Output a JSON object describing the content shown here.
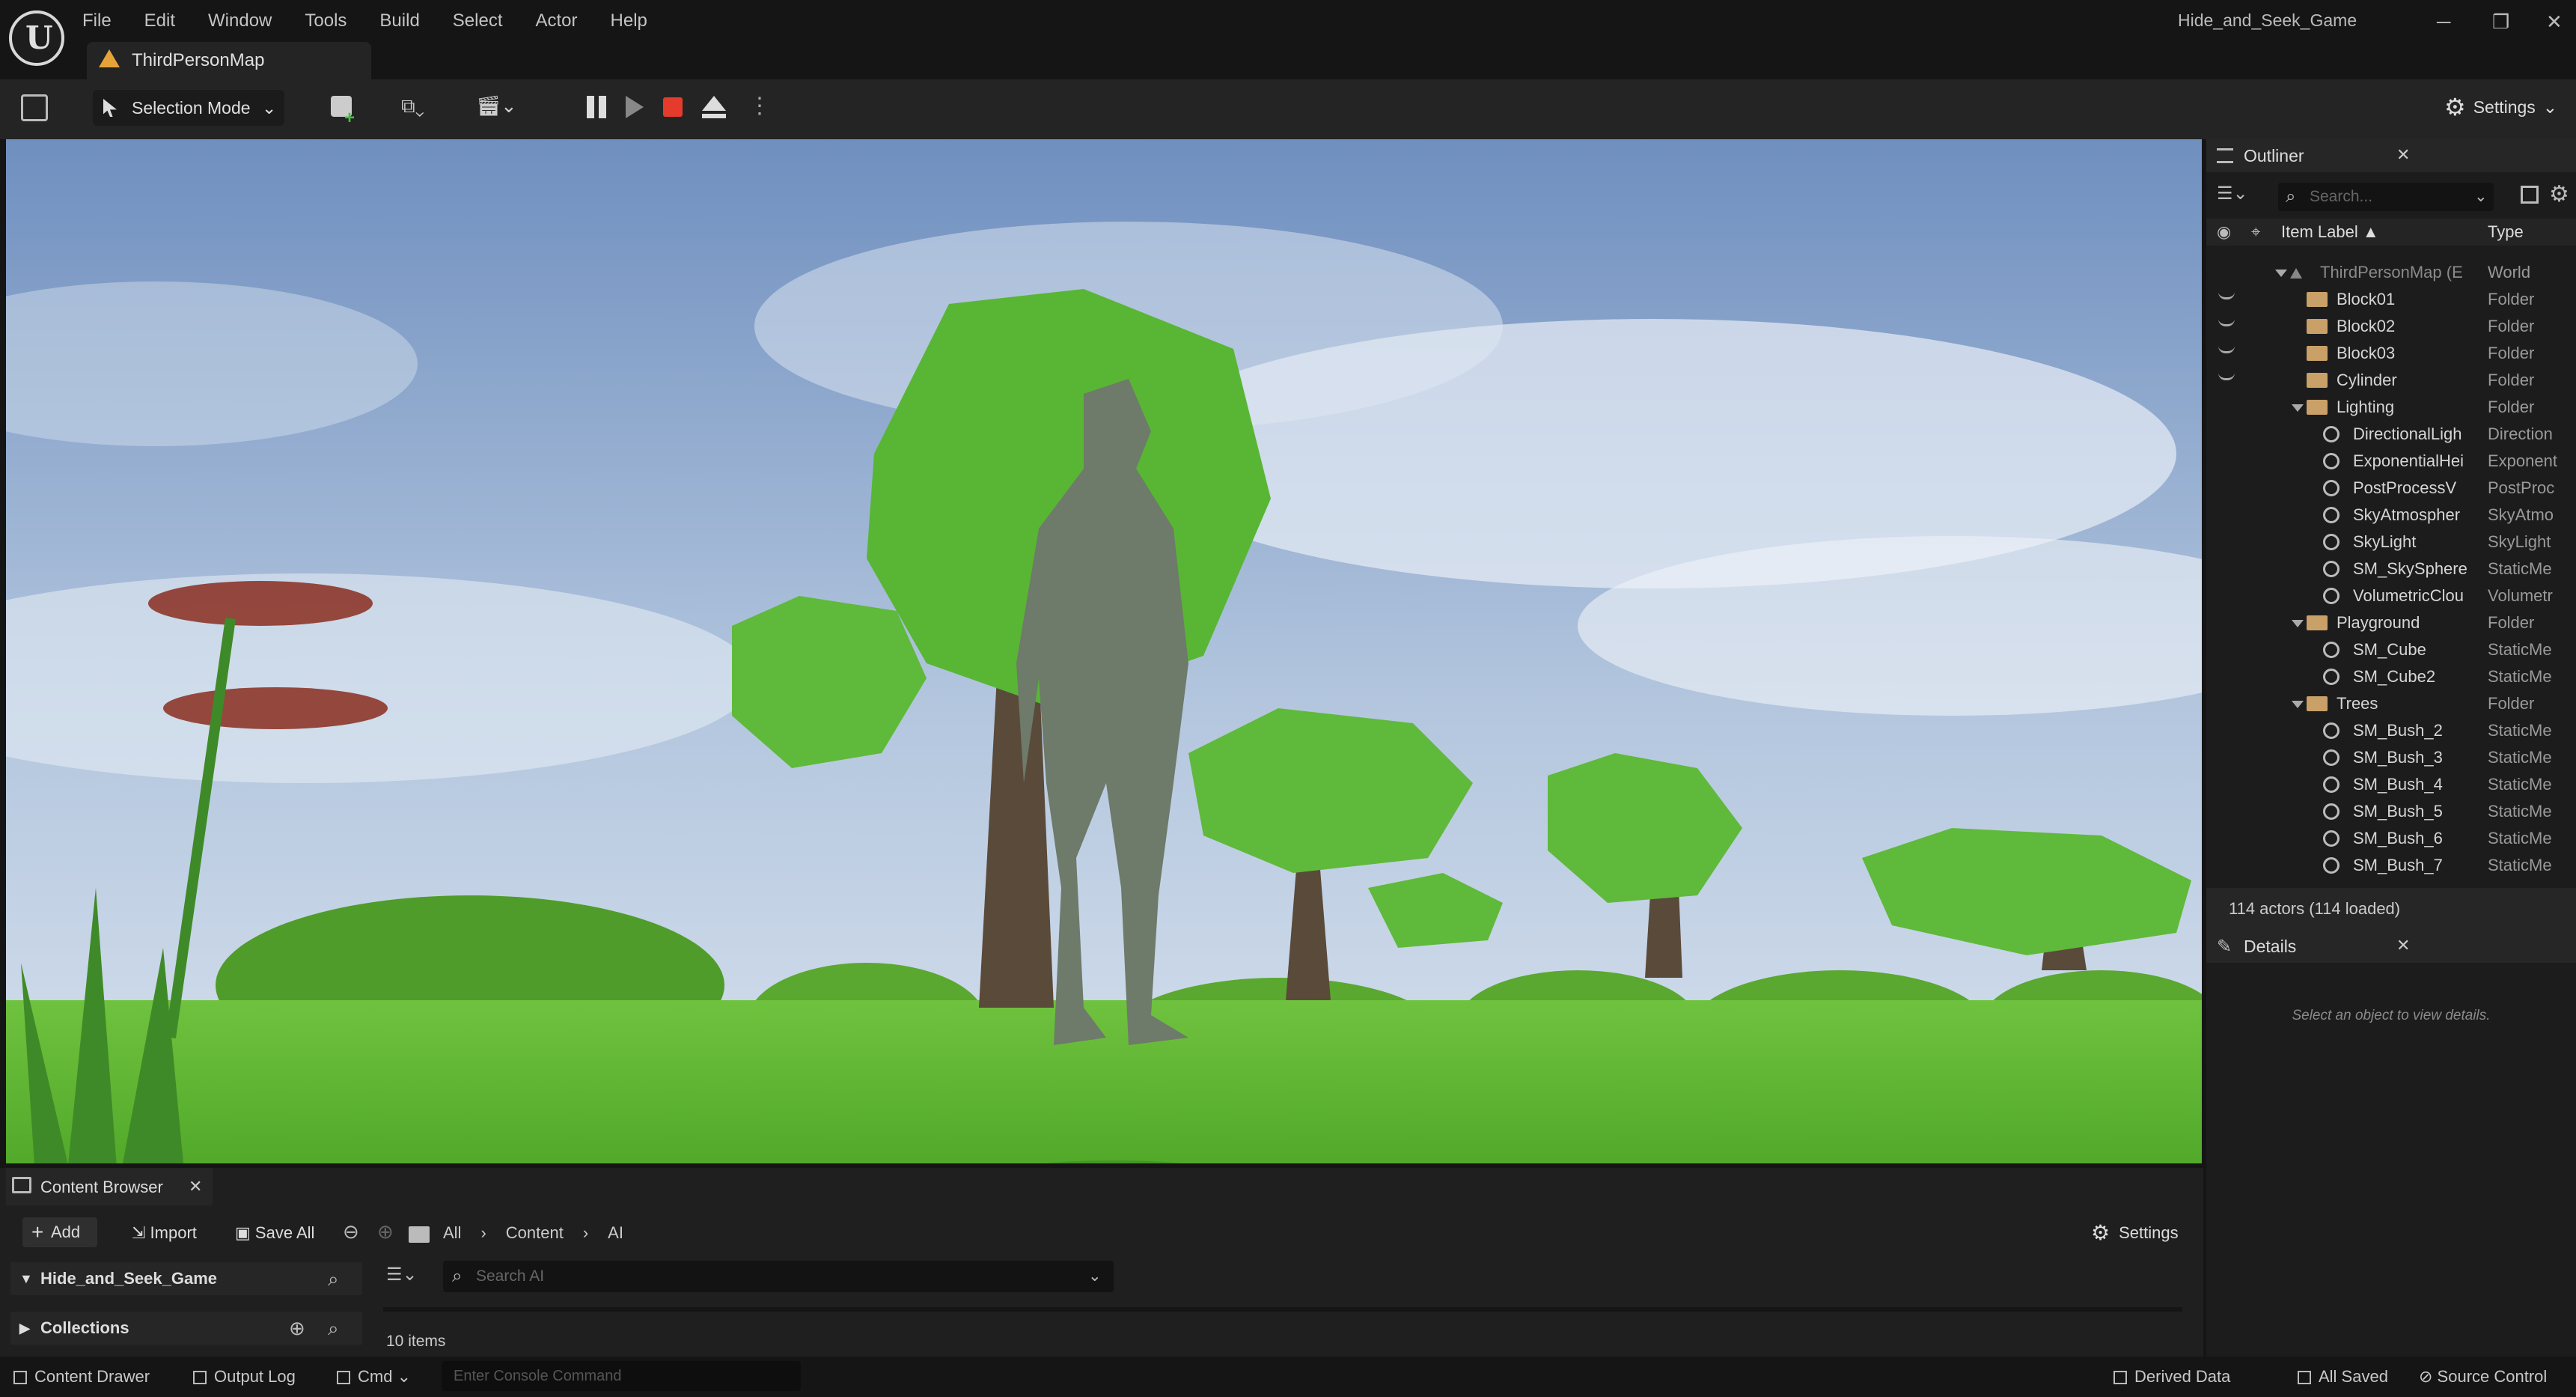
{
  "menu": {
    "items": [
      "File",
      "Edit",
      "Window",
      "Tools",
      "Build",
      "Select",
      "Actor",
      "Help"
    ]
  },
  "level_tab": {
    "label": "ThirdPersonMap"
  },
  "window": {
    "title": "Hide_and_Seek_Game"
  },
  "toolbar": {
    "mode_label": "Selection Mode",
    "settings_label": "Settings"
  },
  "outliner": {
    "tab_label": "Outliner",
    "search_placeholder": "Search...",
    "col_label": "Item Label ▲",
    "col_type": "Type",
    "rows": [
      {
        "label": "ThirdPersonMap (E",
        "type": "World"
      },
      {
        "label": "Block01",
        "type": "Folder"
      },
      {
        "label": "Block02",
        "type": "Folder"
      },
      {
        "label": "Block03",
        "type": "Folder"
      },
      {
        "label": "Cylinder",
        "type": "Folder"
      },
      {
        "label": "Lighting",
        "type": "Folder"
      },
      {
        "label": "DirectionalLigh",
        "type": "Direction"
      },
      {
        "label": "ExponentialHei",
        "type": "Exponent"
      },
      {
        "label": "PostProcessV",
        "type": "PostProc"
      },
      {
        "label": "SkyAtmospher",
        "type": "SkyAtmo"
      },
      {
        "label": "SkyLight",
        "type": "SkyLight"
      },
      {
        "label": "SM_SkySphere",
        "type": "StaticMe"
      },
      {
        "label": "VolumetricClou",
        "type": "Volumetr"
      },
      {
        "label": "Playground",
        "type": "Folder"
      },
      {
        "label": "SM_Cube",
        "type": "StaticMe"
      },
      {
        "label": "SM_Cube2",
        "type": "StaticMe"
      },
      {
        "label": "Trees",
        "type": "Folder"
      },
      {
        "label": "SM_Bush_2",
        "type": "StaticMe"
      },
      {
        "label": "SM_Bush_3",
        "type": "StaticMe"
      },
      {
        "label": "SM_Bush_4",
        "type": "StaticMe"
      },
      {
        "label": "SM_Bush_5",
        "type": "StaticMe"
      },
      {
        "label": "SM_Bush_6",
        "type": "StaticMe"
      },
      {
        "label": "SM_Bush_7",
        "type": "StaticMe"
      }
    ],
    "footer": "114 actors (114 loaded)"
  },
  "details": {
    "tab_label": "Details",
    "empty_text": "Select an object to view details."
  },
  "content_browser": {
    "tab_label": "Content Browser",
    "add_label": "Add",
    "import_label": "Import",
    "save_all_label": "Save All",
    "breadcrumb": [
      "All",
      "Content",
      "AI"
    ],
    "settings_label": "Settings",
    "project_folder": "Hide_and_Seek_Game",
    "collections_label": "Collections",
    "search_placeholder": "Search AI",
    "item_count": "10 items"
  },
  "status": {
    "content_drawer": "Content Drawer",
    "output_log": "Output Log",
    "cmd": "Cmd",
    "console_placeholder": "Enter Console Command",
    "derived_data": "Derived Data",
    "all_saved": "All Saved",
    "source_control": "Source Control"
  }
}
